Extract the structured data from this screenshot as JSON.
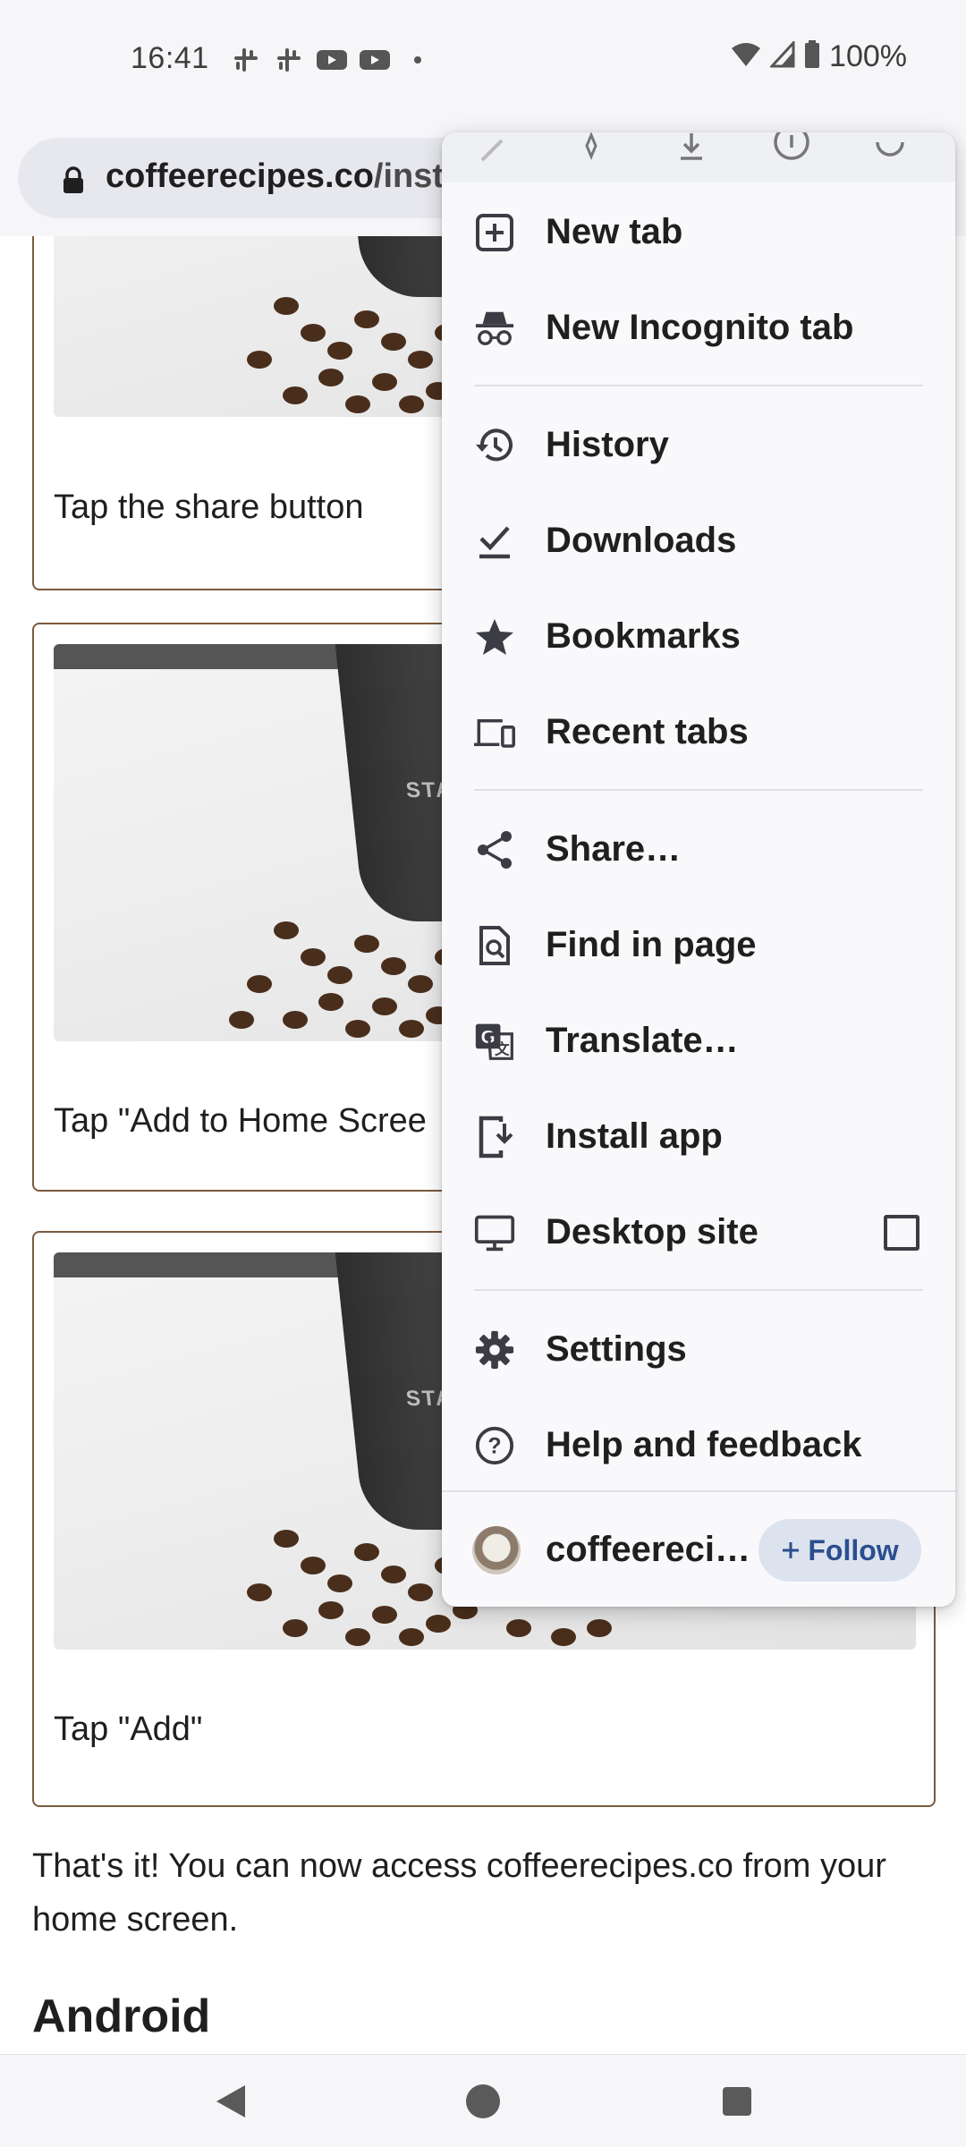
{
  "status_bar": {
    "time": "16:41",
    "left_icons": [
      "slack-icon",
      "slack-icon",
      "youtube-icon",
      "youtube-icon",
      "dot-icon"
    ],
    "battery_text": "100%"
  },
  "url_bar": {
    "host": "coffeerecipes.co",
    "path": "/insta"
  },
  "content": {
    "card1_caption": "Tap the share button",
    "card2_caption": "Tap \"Add to Home Scree",
    "card3_caption": "Tap \"Add\"",
    "photo_cup_text": "STA",
    "paragraph": "That's it! You can now access coffeerecipes.co from your home screen.",
    "heading": "Android"
  },
  "menu": {
    "top_icons": [
      "forward-icon",
      "bookmark-star-icon",
      "download-icon",
      "info-icon",
      "refresh-icon"
    ],
    "items": [
      {
        "label": "New tab",
        "icon": "new-tab-icon"
      },
      {
        "label": "New Incognito tab",
        "icon": "incognito-icon"
      },
      {
        "label": "History",
        "icon": "history-icon"
      },
      {
        "label": "Downloads",
        "icon": "downloads-icon"
      },
      {
        "label": "Bookmarks",
        "icon": "bookmarks-star-icon"
      },
      {
        "label": "Recent tabs",
        "icon": "recent-tabs-icon"
      },
      {
        "label": "Share…",
        "icon": "share-icon"
      },
      {
        "label": "Find in page",
        "icon": "find-in-page-icon"
      },
      {
        "label": "Translate…",
        "icon": "translate-icon"
      },
      {
        "label": "Install app",
        "icon": "install-app-icon"
      },
      {
        "label": "Desktop site",
        "icon": "desktop-icon",
        "checked": false
      },
      {
        "label": "Settings",
        "icon": "settings-gear-icon"
      },
      {
        "label": "Help and feedback",
        "icon": "help-icon"
      }
    ],
    "footer": {
      "site": "coffeereci…",
      "follow_label": "Follow"
    }
  }
}
